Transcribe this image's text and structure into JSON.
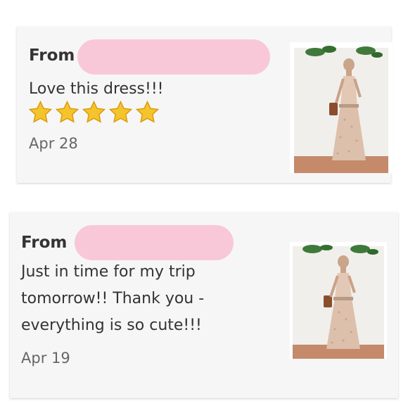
{
  "reviews": [
    {
      "from_label": "From",
      "message": "Love this dress!!!",
      "rating": 5,
      "date": "Apr 28"
    },
    {
      "from_label": "From",
      "message_lines": [
        "Just in time for my trip",
        "tomorrow!! Thank you -",
        "everything is so cute!!!"
      ],
      "date": "Apr 19"
    }
  ],
  "colors": {
    "redaction": "#f8c8d9",
    "star": "#f5c42c",
    "card": "#f6f6f6"
  }
}
